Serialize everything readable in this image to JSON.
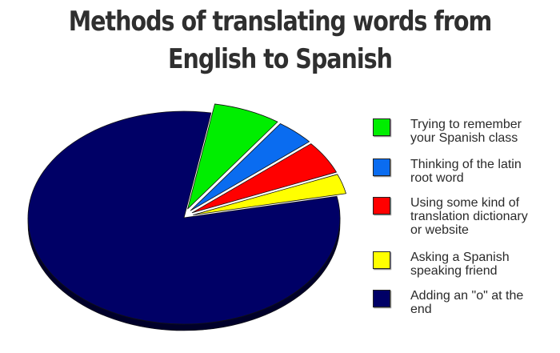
{
  "title_lines": [
    "Methods of translating words from",
    "English to Spanish"
  ],
  "chart_data": {
    "type": "pie",
    "title": "Methods of translating words from English to Spanish",
    "legend_position": "right",
    "slices": [
      {
        "label": "Trying to remember your Spanish class",
        "value": 7,
        "color": "#00ee00",
        "side": "#008800"
      },
      {
        "label": "Thinking of the latin root word",
        "value": 4,
        "color": "#0a6cf0",
        "side": "#043a88"
      },
      {
        "label": "Using some kind of translation dictionary or website",
        "value": 5,
        "color": "#ff0000",
        "side": "#8a0000"
      },
      {
        "label": "Asking a Spanish speaking friend",
        "value": 3,
        "color": "#ffff00",
        "side": "#8a8a00"
      },
      {
        "label": "Adding an \"o\" at the end",
        "value": 81,
        "color": "#000066",
        "side": "#00002a"
      }
    ]
  }
}
